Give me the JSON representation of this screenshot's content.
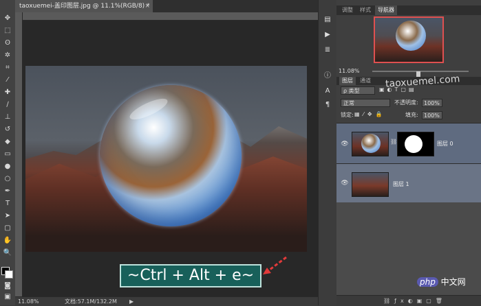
{
  "document": {
    "tab_title": "taoxuemei-盖印图层.jpg @ 11.1%(RGB/8) *",
    "close_glyph": "×",
    "status_zoom": "11.08%",
    "status_doc": "文档:57.1M/132.2M",
    "status_arrow": "▶"
  },
  "overlay": {
    "shortcut": "~Ctrl + Alt + e~",
    "watermark": "taoxuemel.com",
    "php_badge": "php",
    "php_label": "中文网"
  },
  "top_panel": {
    "tabs": [
      "调整",
      "样式",
      "导航器"
    ],
    "active_tab": "导航器",
    "zoom": "11.08%"
  },
  "layers_panel": {
    "tabs": [
      "图层",
      "通道"
    ],
    "kind_filter": "ρ 类型",
    "blend_mode": "正常",
    "opacity_label": "不透明度:",
    "opacity_value": "100%",
    "lock_label": "锁定:",
    "fill_label": "填充:",
    "fill_value": "100%",
    "layers": [
      {
        "name": "图层 0",
        "selected": true,
        "has_mask": true
      },
      {
        "name": "图层 1",
        "selected": false,
        "has_mask": false
      }
    ]
  },
  "icons": {
    "tools": [
      "move-tool-icon",
      "marquee-tool-icon",
      "lasso-tool-icon",
      "magic-wand-icon",
      "crop-tool-icon",
      "eyedropper-icon",
      "healing-brush-icon",
      "brush-icon",
      "clone-stamp-icon",
      "history-brush-icon",
      "eraser-icon",
      "gradient-icon",
      "blur-icon",
      "dodge-icon",
      "pen-icon",
      "type-icon",
      "path-select-icon",
      "shape-icon",
      "hand-icon",
      "zoom-icon"
    ]
  },
  "colors": {
    "accent_red": "#e05050",
    "shortcut_bg": "#18605a",
    "layer_selected": "#5f6b80"
  }
}
